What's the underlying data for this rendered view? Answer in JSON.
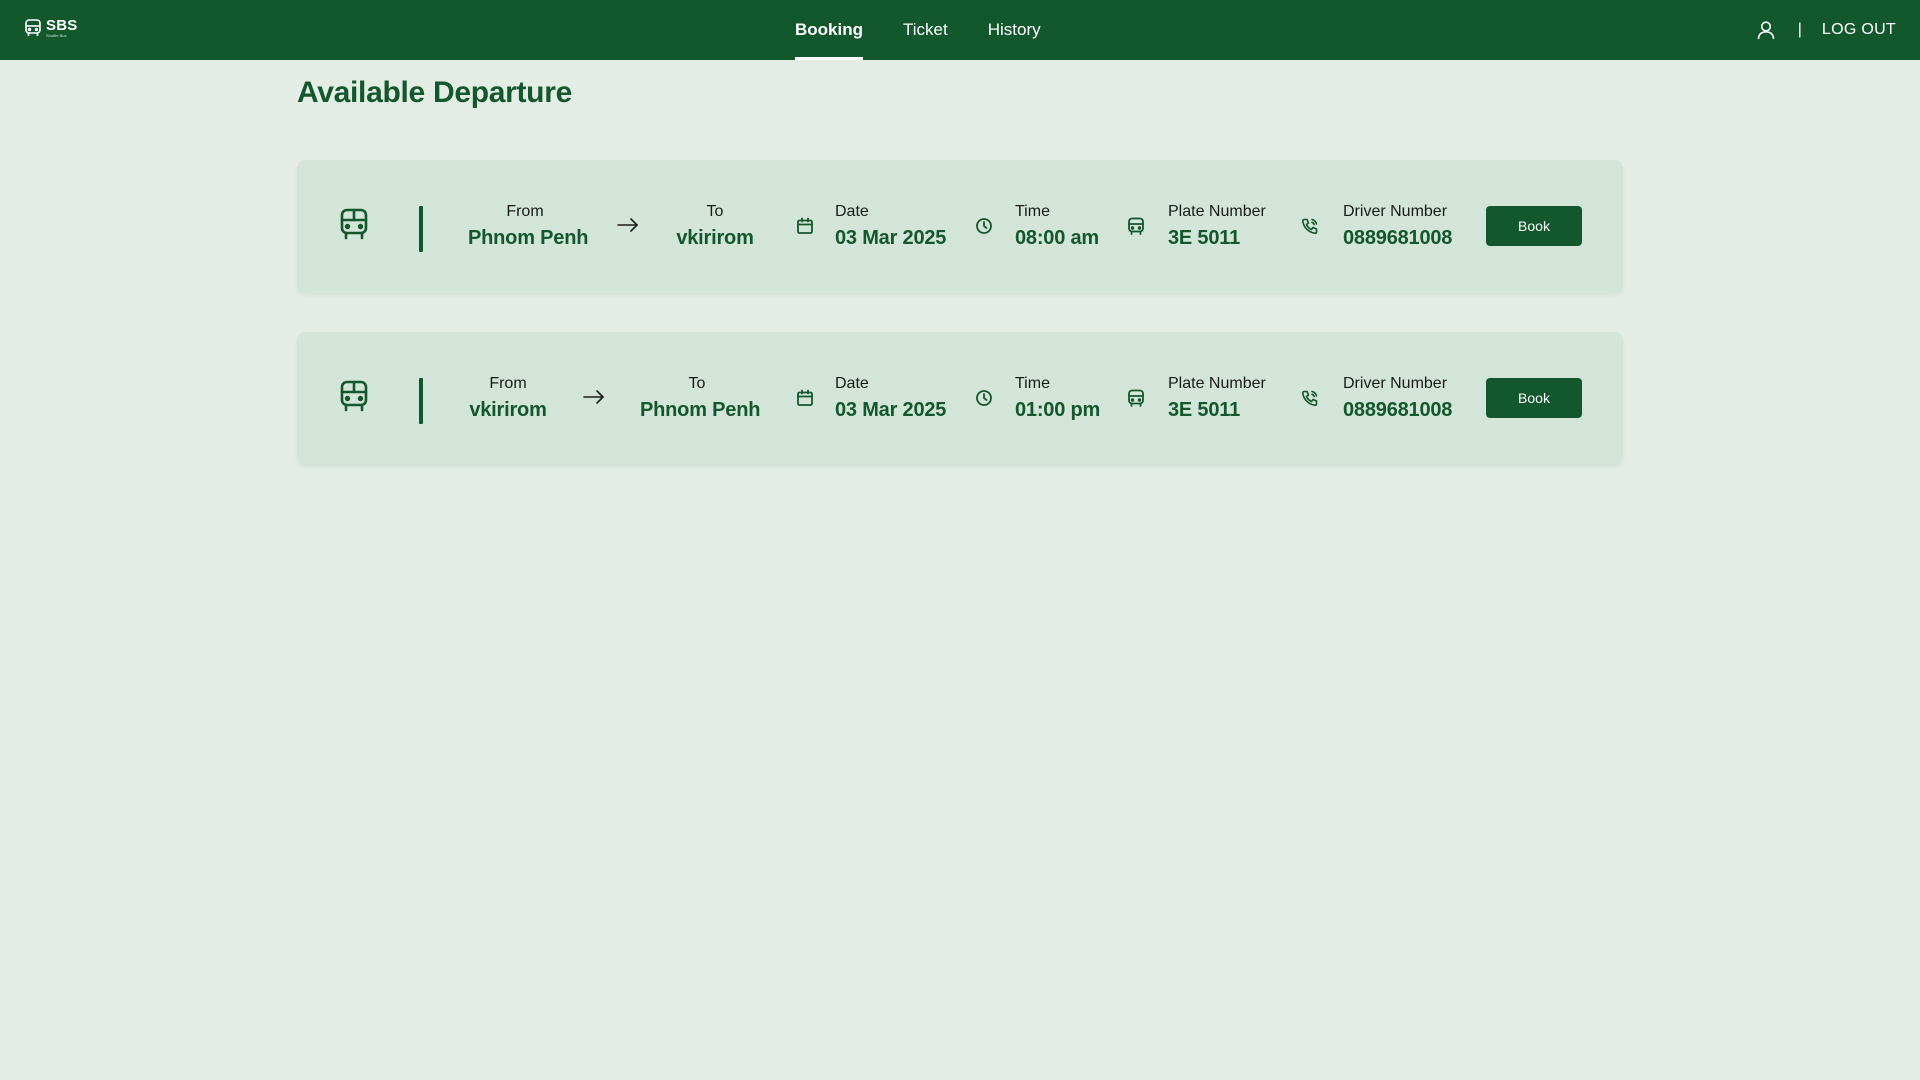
{
  "header": {
    "logo_text": "SBS",
    "logo_subtext": "Shuttle Bus",
    "nav": [
      {
        "label": "Booking",
        "active": true
      },
      {
        "label": "Ticket",
        "active": false
      },
      {
        "label": "History",
        "active": false
      }
    ],
    "divider": "|",
    "logout_label": "LOG OUT"
  },
  "page": {
    "title": "Available Departure"
  },
  "departures": [
    {
      "from_label": "From",
      "from": "Phnom Penh",
      "to_label": "To",
      "to": "vkirirom",
      "date_label": "Date",
      "date": "03 Mar 2025",
      "time_label": "Time",
      "time": "08:00 am",
      "plate_label": "Plate Number",
      "plate": "3E 5011",
      "driver_label": "Driver Number",
      "driver": "0889681008",
      "book_label": "Book"
    },
    {
      "from_label": "From",
      "from": "vkirirom",
      "to_label": "To",
      "to": "Phnom Penh",
      "date_label": "Date",
      "date": "03 Mar 2025",
      "time_label": "Time",
      "time": "01:00 pm",
      "plate_label": "Plate Number",
      "plate": "3E 5011",
      "driver_label": "Driver Number",
      "driver": "0889681008",
      "book_label": "Book"
    }
  ],
  "colors": {
    "primary": "#13572d",
    "background": "#e3ede5",
    "card": "#d3e4d8"
  },
  "icons": [
    "bus-icon",
    "arrow-right-icon",
    "calendar-icon",
    "clock-icon",
    "user-icon"
  ]
}
